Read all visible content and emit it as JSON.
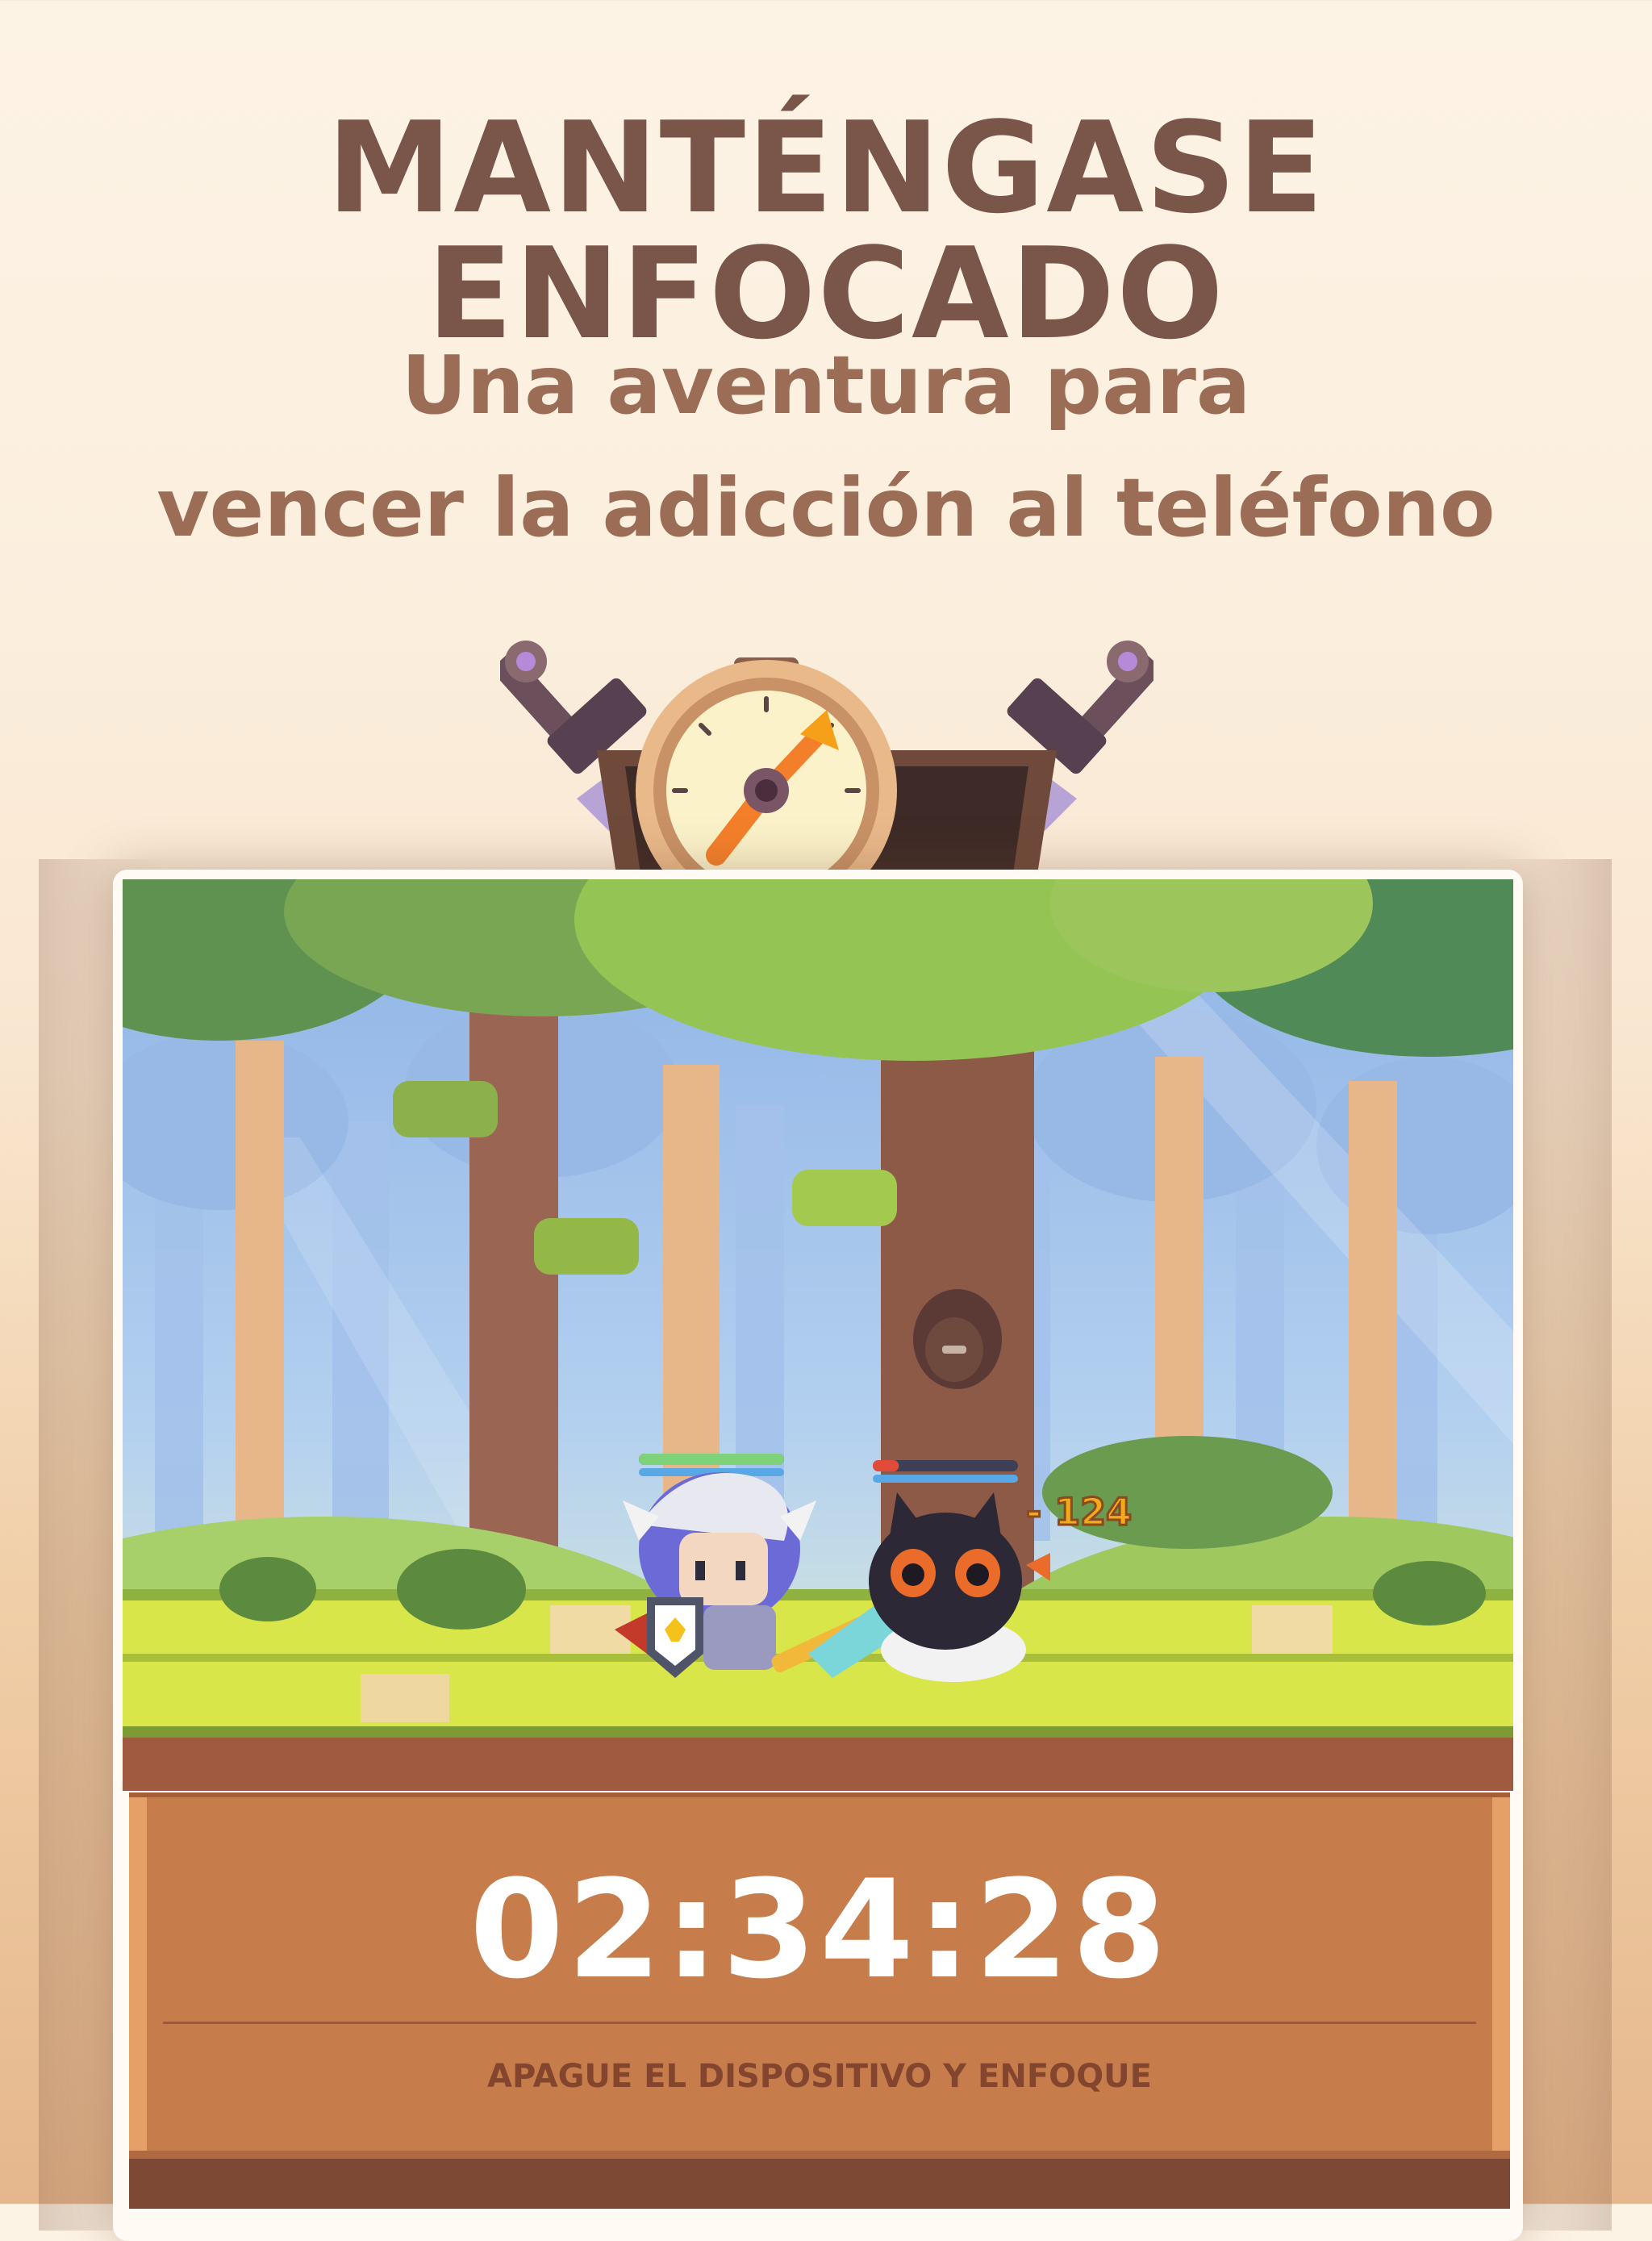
{
  "header": {
    "title": "MANTÉNGASE ENFOCADO",
    "subtitle_line1": "Una aventura para",
    "subtitle_line2": "vencer la adicción al teléfono"
  },
  "game": {
    "damage_popup": "- 124",
    "timer": "02:34:28",
    "hint": "APAGUE EL DISPOSITIVO Y ENFOQUE",
    "hero_health_fraction": 1.0,
    "enemy_health_fraction": 0.18
  },
  "colors": {
    "title": "#7a554a",
    "subtitle": "#9b6d56",
    "board": "#c77c4b",
    "timer_text": "#ffffff",
    "hint_text": "#83452e"
  }
}
